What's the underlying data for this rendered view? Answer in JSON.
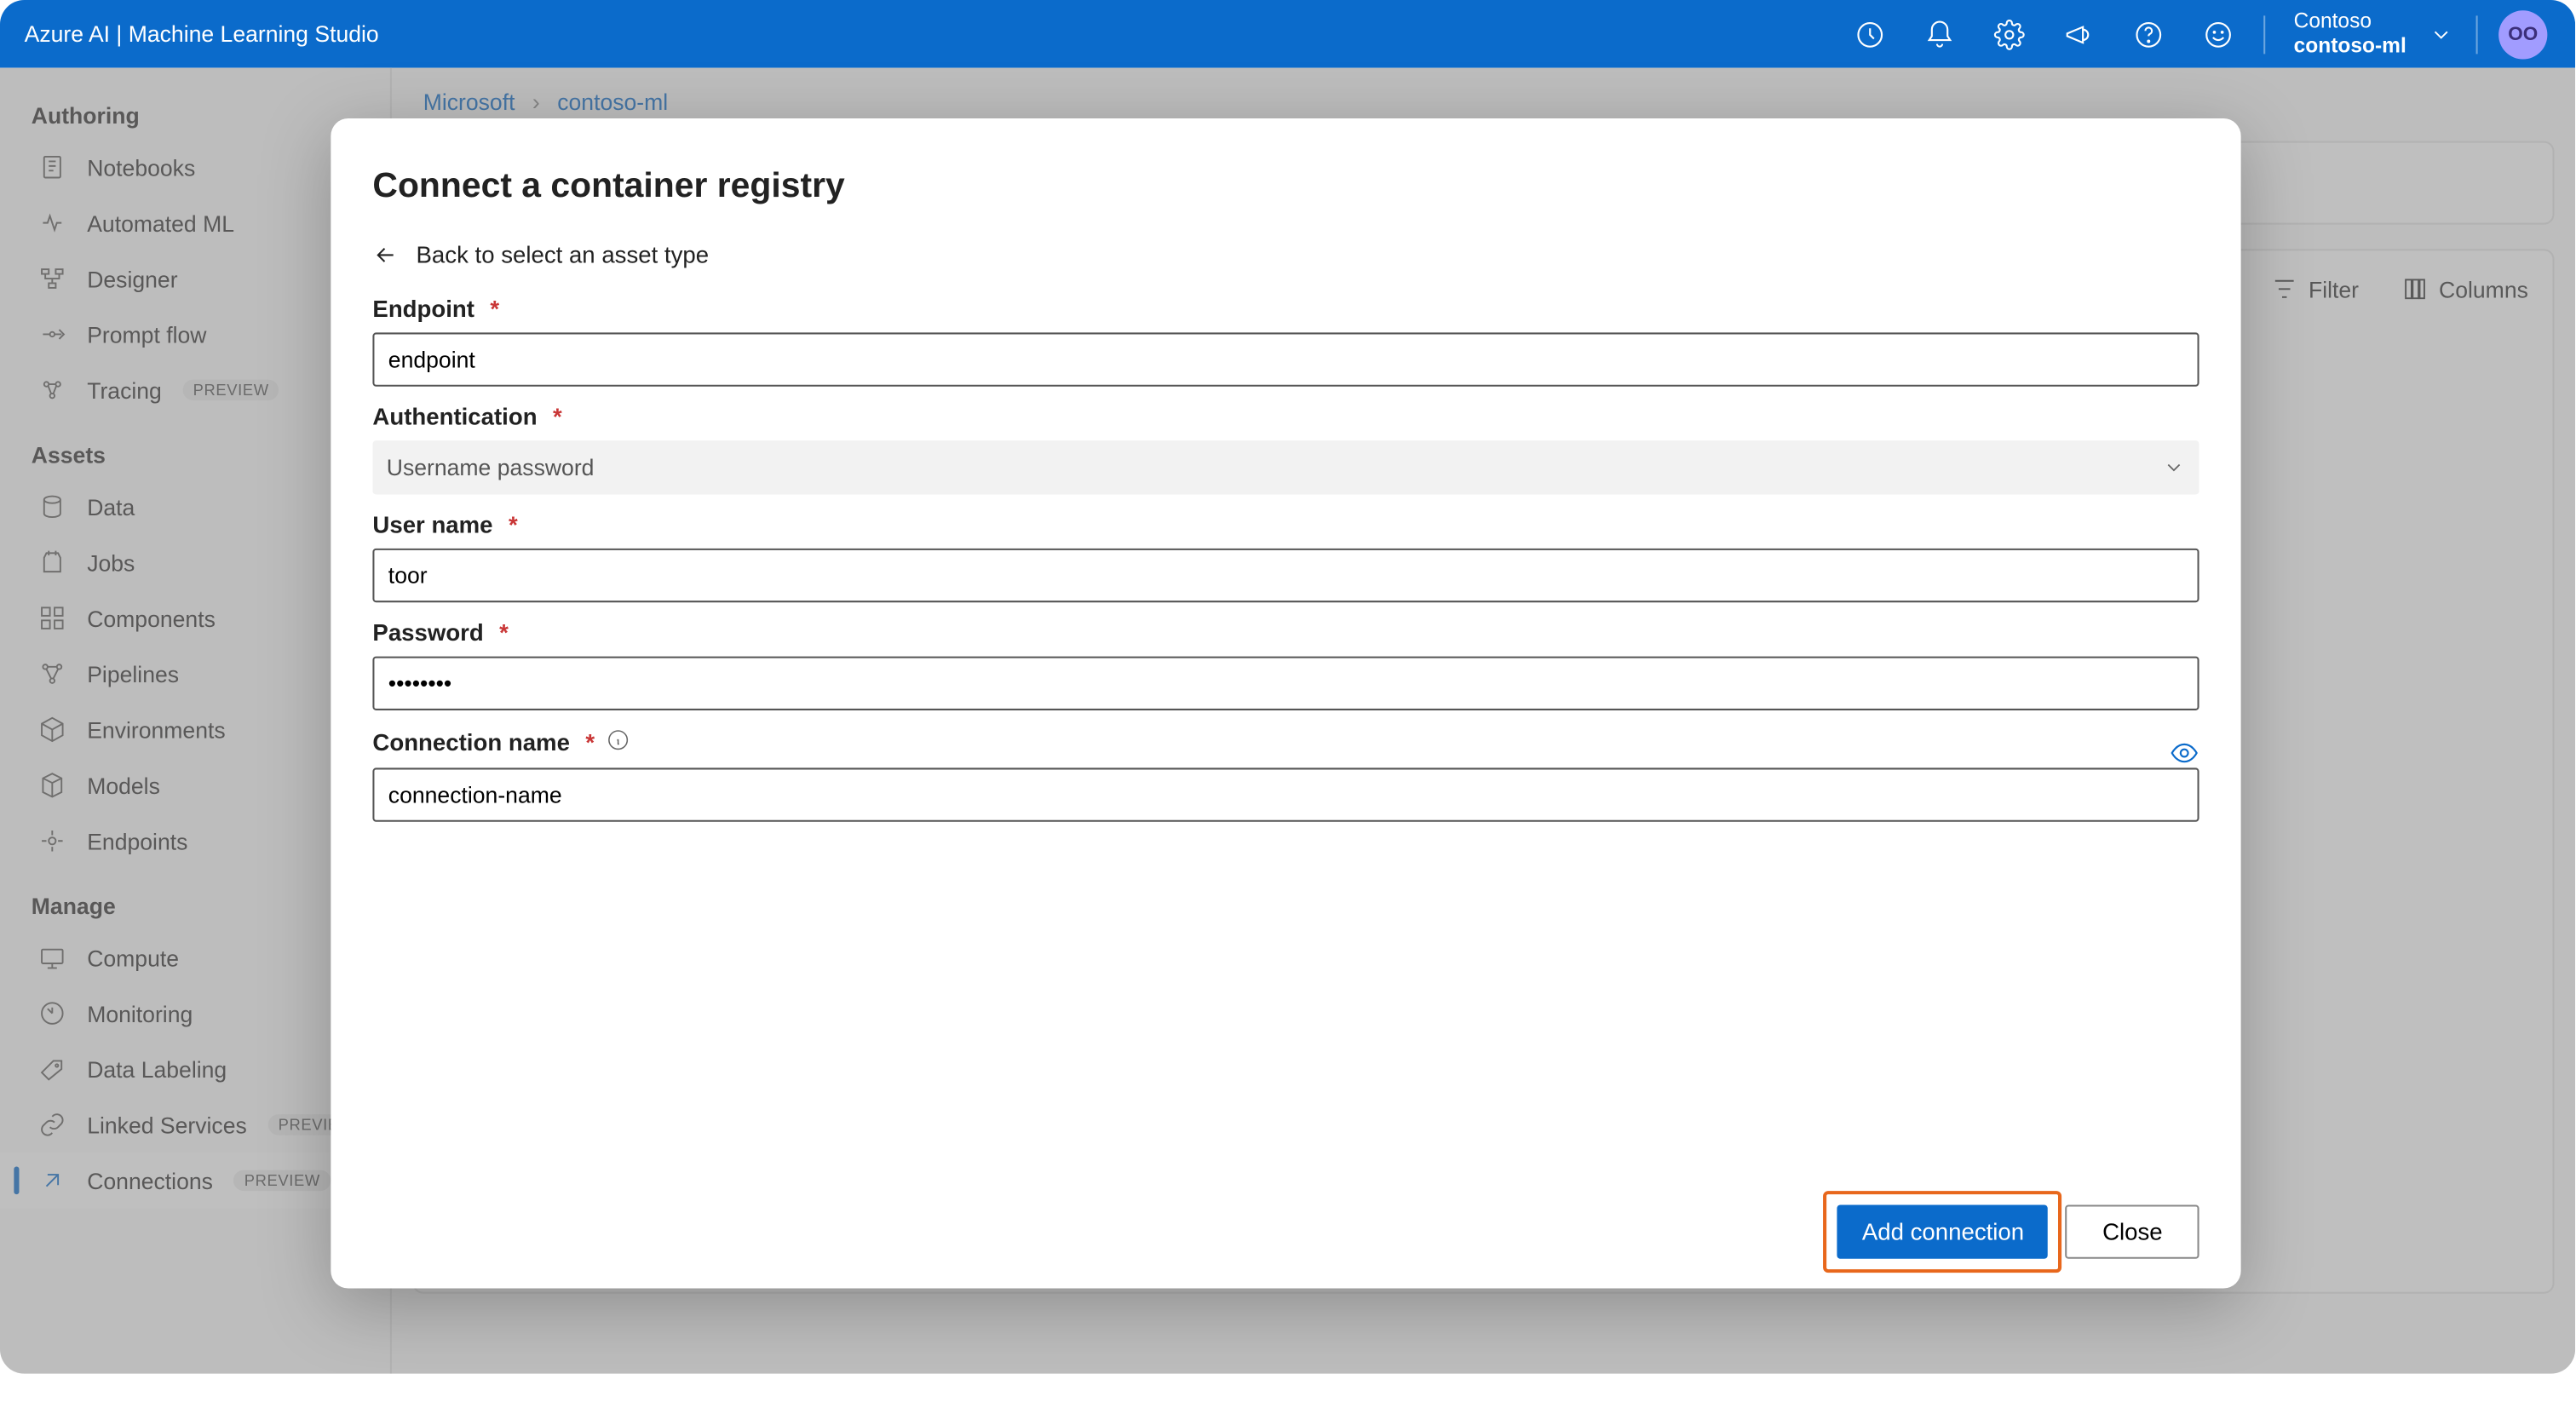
{
  "topbar": {
    "title": "Azure AI | Machine Learning Studio",
    "workspace": {
      "tenant": "Contoso",
      "name": "contoso-ml"
    },
    "avatar": "OO"
  },
  "breadcrumb": {
    "root": "Microsoft",
    "current": "contoso-ml"
  },
  "sidebar": {
    "sections": [
      {
        "label": "Authoring",
        "items": [
          {
            "label": "Notebooks"
          },
          {
            "label": "Automated ML"
          },
          {
            "label": "Designer"
          },
          {
            "label": "Prompt flow"
          },
          {
            "label": "Tracing",
            "preview": "PREVIEW"
          }
        ]
      },
      {
        "label": "Assets",
        "items": [
          {
            "label": "Data"
          },
          {
            "label": "Jobs"
          },
          {
            "label": "Components"
          },
          {
            "label": "Pipelines"
          },
          {
            "label": "Environments"
          },
          {
            "label": "Models"
          },
          {
            "label": "Endpoints"
          }
        ]
      },
      {
        "label": "Manage",
        "items": [
          {
            "label": "Compute"
          },
          {
            "label": "Monitoring"
          },
          {
            "label": "Data Labeling"
          },
          {
            "label": "Linked Services",
            "preview": "PREVIEW"
          },
          {
            "label": "Connections",
            "preview": "PREVIEW",
            "active": true
          }
        ]
      }
    ]
  },
  "toolbar": {
    "filter": "Filter",
    "columns": "Columns"
  },
  "modal": {
    "title": "Connect a container registry",
    "back": "Back to select an asset type",
    "fields": {
      "endpoint": {
        "label": "Endpoint",
        "value": "endpoint"
      },
      "auth": {
        "label": "Authentication",
        "value": "Username password"
      },
      "username": {
        "label": "User name",
        "value": "toor"
      },
      "password": {
        "label": "Password",
        "value": "••••••••"
      },
      "connname": {
        "label": "Connection name",
        "value": "connection-name"
      }
    },
    "buttons": {
      "add": "Add connection",
      "close": "Close"
    }
  }
}
